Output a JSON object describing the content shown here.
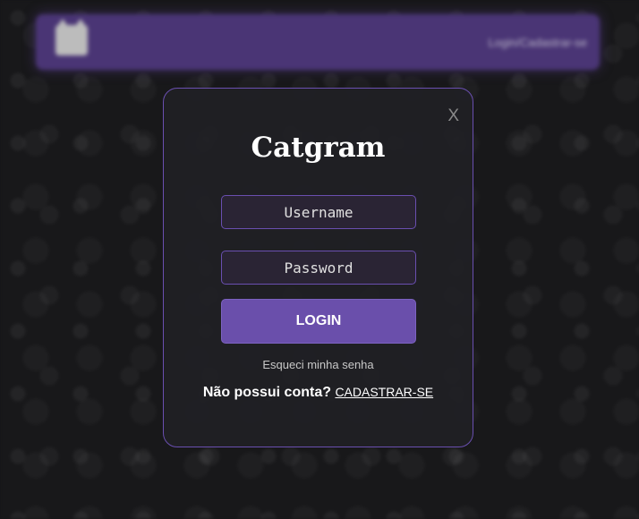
{
  "navbar": {
    "logo_icon": "cat-logo-icon",
    "link_label": "Login/Cadastrar-se"
  },
  "modal": {
    "close_label": "X",
    "title": "Catgram",
    "username_placeholder": "Username",
    "password_placeholder": "Password",
    "login_label": "LOGIN",
    "forgot_label": "Esqueci minha senha",
    "signup_question": "Não possui conta?",
    "signup_link": "CADASTRAR-SE"
  },
  "colors": {
    "accent": "#6a4fab",
    "navbar": "#4a3575",
    "background": "#18181a"
  }
}
